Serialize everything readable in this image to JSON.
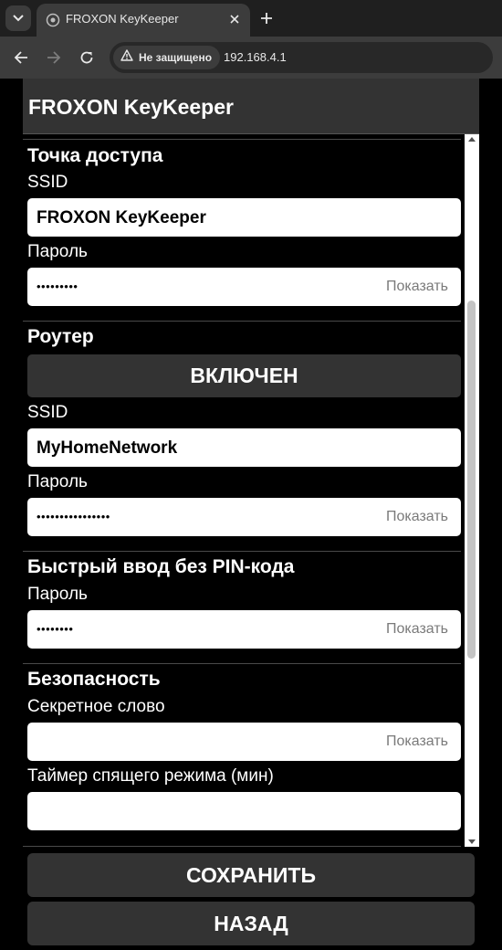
{
  "browser": {
    "tab_title": "FROXON KeyKeeper",
    "security_label": "Не защищено",
    "url": "192.168.4.1",
    "icons": {
      "tab_menu": "chevron-down-icon",
      "favicon": "globe-icon",
      "close": "close-icon",
      "new_tab": "plus-icon",
      "back": "arrow-left-icon",
      "forward": "arrow-right-icon",
      "reload": "reload-icon",
      "security": "warning-icon"
    }
  },
  "app": {
    "title": "FROXON KeyKeeper",
    "colors": {
      "background": "#000000",
      "panel": "#333333",
      "input": "#ffffff",
      "show_link": "#7a7a7a"
    },
    "scroll_position": 0.23
  },
  "access_point": {
    "title": "Точка доступа",
    "ssid_label": "SSID",
    "ssid_value": "FROXON KeyKeeper",
    "password_label": "Пароль",
    "password_masked": "•••••••••",
    "show_label": "Показать"
  },
  "router": {
    "title": "Роутер",
    "toggle_label": "ВКЛЮЧЕН",
    "ssid_label": "SSID",
    "ssid_value": "MyHomeNetwork",
    "password_label": "Пароль",
    "password_masked": "••••••••••••••••",
    "show_label": "Показать"
  },
  "quick_entry": {
    "title": "Быстрый ввод без PIN-кода",
    "password_label": "Пароль",
    "password_masked": "••••••••",
    "show_label": "Показать"
  },
  "security": {
    "title": "Безопасность",
    "secret_label": "Секретное слово",
    "secret_value": "",
    "show_label": "Показать",
    "sleep_timer_label": "Таймер спящего режима (мин)",
    "sleep_timer_value": ""
  },
  "actions": {
    "save_label": "СОХРАНИТЬ",
    "back_label": "НАЗАД"
  }
}
